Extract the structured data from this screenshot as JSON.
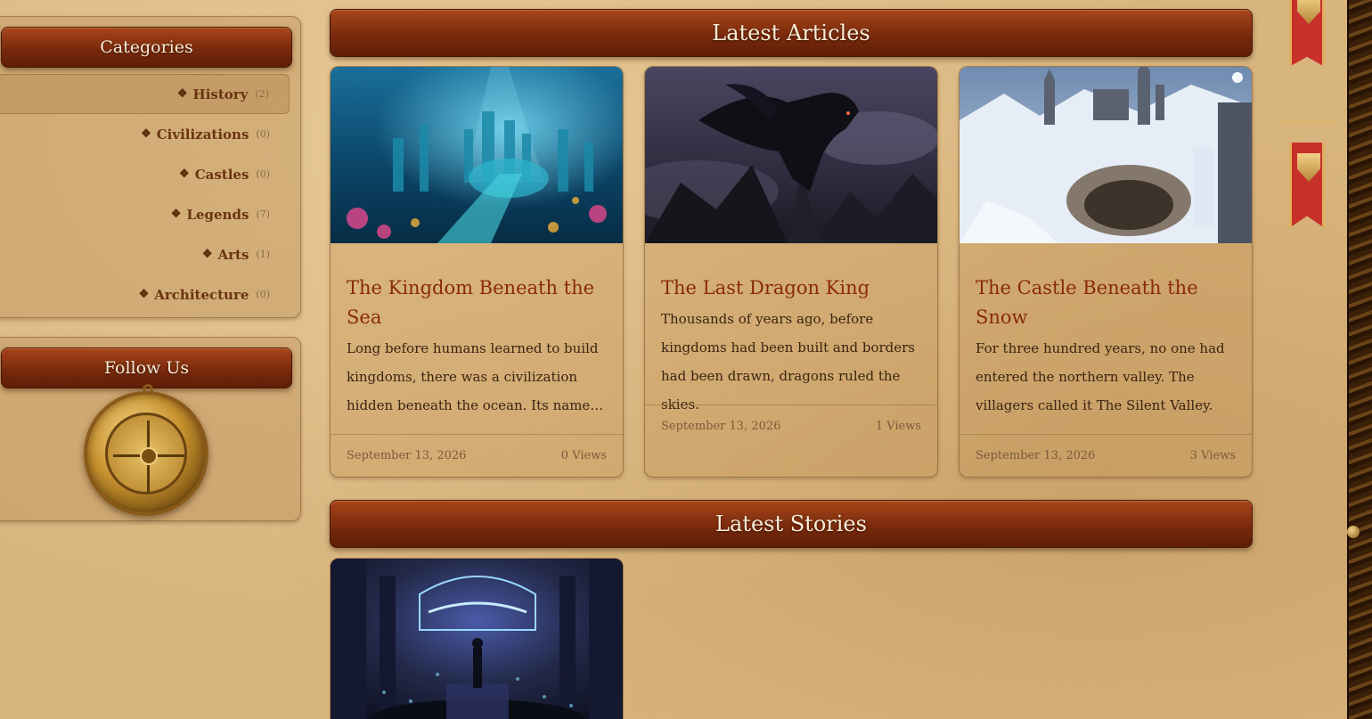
{
  "sidebar": {
    "categories_title": "Categories",
    "categories": [
      {
        "label": "History",
        "count": "(2)"
      },
      {
        "label": "Civilizations",
        "count": "(0)"
      },
      {
        "label": "Castles",
        "count": "(0)"
      },
      {
        "label": "Legends",
        "count": "(7)"
      },
      {
        "label": "Arts",
        "count": "(1)"
      },
      {
        "label": "Architecture",
        "count": "(0)"
      }
    ],
    "follow_title": "Follow Us"
  },
  "articles": {
    "title": "Latest Articles",
    "items": [
      {
        "title": "The Kingdom Beneath the Sea",
        "excerpt": "Long before humans learned to build kingdoms, there was a civilization hidden beneath the ocean. Its name was…",
        "date": "September 13, 2026",
        "views": "0 Views"
      },
      {
        "title": "The Last Dragon King",
        "excerpt": "Thousands of years ago, before kingdoms had been built and borders had been drawn, dragons ruled the skies.",
        "date": "September 13, 2026",
        "views": "1 Views"
      },
      {
        "title": "The Castle Beneath the Snow",
        "excerpt": "For three hundred years, no one had entered the northern valley. The villagers called it The Silent Valley.",
        "date": "September 13, 2026",
        "views": "3 Views"
      }
    ]
  },
  "stories": {
    "title": "Latest Stories"
  },
  "colors": {
    "banner": "#7a2a0c",
    "parchment": "#d9b57e",
    "title_red": "#8a2a0a"
  }
}
